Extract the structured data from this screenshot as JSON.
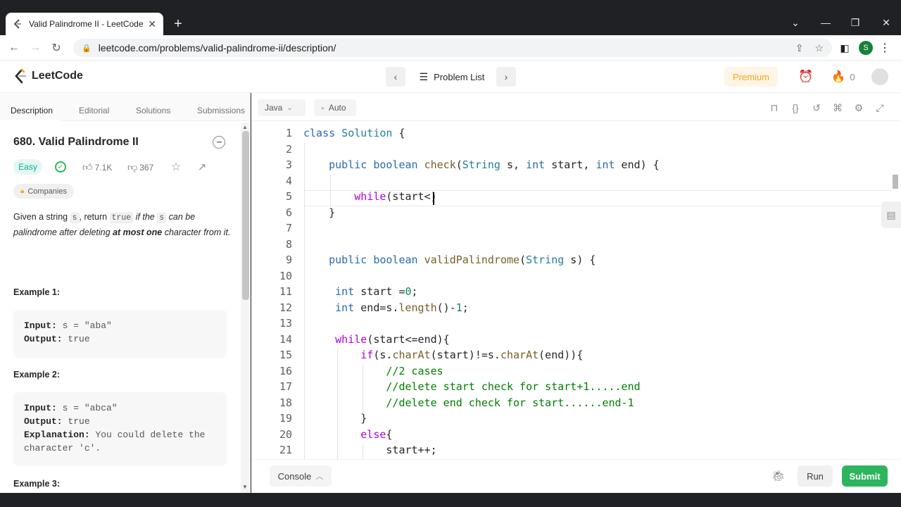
{
  "browser": {
    "tab_title": "Valid Palindrome II - LeetCode",
    "tab_close": "✕",
    "new_tab": "+",
    "url": "leetcode.com/problems/valid-palindrome-ii/description/",
    "profile_initial": "S"
  },
  "nav": {
    "logo_text": "LeetCode",
    "problem_list": "Problem List",
    "premium": "Premium",
    "streak_count": "0"
  },
  "left_tabs": [
    "Description",
    "Editorial",
    "Solutions",
    "Submissions"
  ],
  "problem": {
    "title": "680. Valid Palindrome II",
    "difficulty": "Easy",
    "likes": "7.1K",
    "dislikes": "367",
    "companies": "Companies",
    "desc": {
      "t1": "Given a string ",
      "c1": "s",
      "t2": ", return ",
      "c2": "true",
      "t3": " if the ",
      "c3": "s",
      "t4": " can be palindrome after deleting ",
      "b1": "at most one",
      "t5": " character from it."
    },
    "examples": [
      {
        "heading": "Example 1:",
        "input_label": "Input:",
        "input": " s = \"aba\"",
        "output_label": "Output:",
        "output": " true"
      },
      {
        "heading": "Example 2:",
        "input_label": "Input:",
        "input": " s = \"abca\"",
        "output_label": "Output:",
        "output": " true",
        "explanation_label": "Explanation:",
        "explanation": " You could delete the character 'c'."
      },
      {
        "heading": "Example 3:"
      }
    ]
  },
  "editor": {
    "language": "Java",
    "mode": "Auto",
    "lines": [
      {
        "n": "1",
        "code": "class Solution {"
      },
      {
        "n": "2",
        "code": ""
      },
      {
        "n": "3",
        "code": "    public boolean check(String s, int start, int end) {"
      },
      {
        "n": "4",
        "code": ""
      },
      {
        "n": "5",
        "code": "        while(start<)"
      },
      {
        "n": "6",
        "code": "    }"
      },
      {
        "n": "7",
        "code": ""
      },
      {
        "n": "8",
        "code": ""
      },
      {
        "n": "9",
        "code": "    public boolean validPalindrome(String s) {"
      },
      {
        "n": "10",
        "code": ""
      },
      {
        "n": "11",
        "code": "     int start =0;"
      },
      {
        "n": "12",
        "code": "     int end=s.length()-1;"
      },
      {
        "n": "13",
        "code": ""
      },
      {
        "n": "14",
        "code": "     while(start<=end){"
      },
      {
        "n": "15",
        "code": "         if(s.charAt(start)!=s.charAt(end)){"
      },
      {
        "n": "16",
        "code": "             //2 cases"
      },
      {
        "n": "17",
        "code": "             //delete start check for start+1.....end"
      },
      {
        "n": "18",
        "code": "             //delete end check for start......end-1"
      },
      {
        "n": "19",
        "code": "         }"
      },
      {
        "n": "20",
        "code": "         else{"
      },
      {
        "n": "21",
        "code": "             start++;"
      }
    ]
  },
  "bottom": {
    "console": "Console",
    "run": "Run",
    "submit": "Submit"
  },
  "colors": {
    "accent_orange": "#ffa116",
    "easy_green": "#00af9b",
    "submit_green": "#2db55d"
  }
}
